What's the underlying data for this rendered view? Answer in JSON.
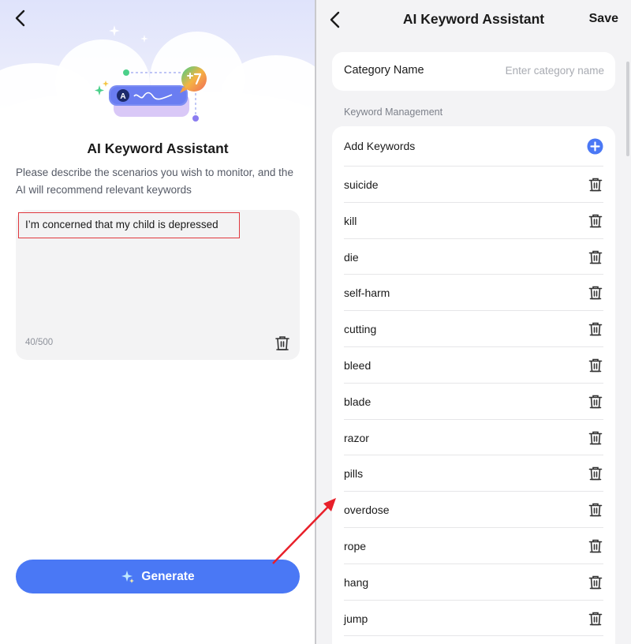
{
  "left_panel": {
    "title": "AI Keyword Assistant",
    "description": "Please describe the scenarios you wish to monitor, and the AI will recommend relevant keywords",
    "input_value": "I’m concerned that my child is depressed",
    "char_count": "40/500",
    "generate_label": "Generate",
    "illustration_badge_letter": "A"
  },
  "right_panel": {
    "title": "AI Keyword Assistant",
    "save_label": "Save",
    "category_label": "Category Name",
    "category_placeholder": "Enter category name",
    "section_label": "Keyword Management",
    "add_keywords_label": "Add Keywords",
    "keywords": [
      "suicide",
      "kill",
      "die",
      "self-harm",
      "cutting",
      "bleed",
      "blade",
      "razor",
      "pills",
      "overdose",
      "rope",
      "hang",
      "jump"
    ]
  },
  "icons": {
    "back": "chevron-left-icon",
    "trash": "trash-icon",
    "add": "plus-circle-icon",
    "sparkle": "sparkle-icon"
  },
  "colors": {
    "accent": "#4a78f5",
    "highlight_border": "#e0383e",
    "annotation_arrow": "#e8202a"
  }
}
